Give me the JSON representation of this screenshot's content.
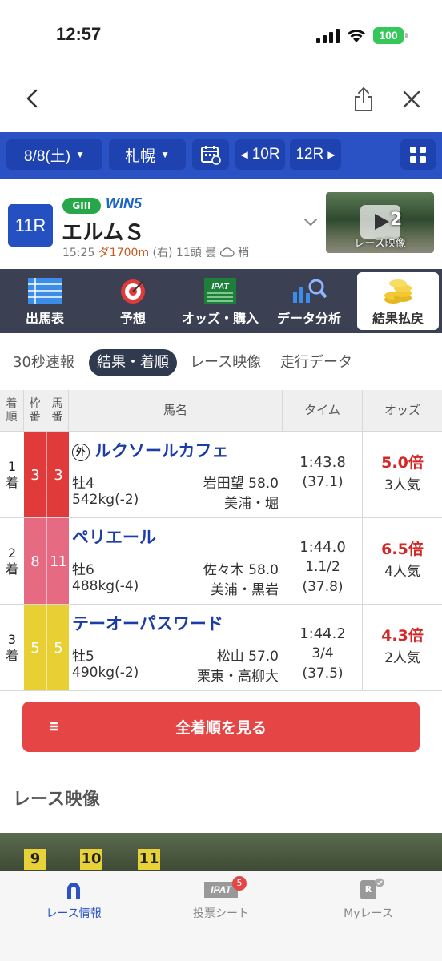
{
  "status": {
    "time": "12:57",
    "battery": "100"
  },
  "header": {
    "date": "8/8(土)",
    "venue": "札幌",
    "prev_race": "10R",
    "next_race": "12R"
  },
  "race": {
    "number": "11R",
    "grade": "GIII",
    "win5_label": "WIN",
    "win5_num": "5",
    "name": "エルムＳ",
    "time": "15:25",
    "course": "ダ1700m",
    "meta_rest": "(右) 11頭 曇",
    "track_cond": "稍",
    "video_label": "レース映像",
    "video_num": "2"
  },
  "menu": [
    "出馬表",
    "予想",
    "オッズ・購入",
    "データ分析",
    "結果払戻"
  ],
  "subtabs": [
    "30秒速報",
    "結果・着順",
    "レース映像",
    "走行データ"
  ],
  "table": {
    "headers": {
      "rank": "着順",
      "waku": "枠番",
      "uma": "馬番",
      "name": "馬名",
      "time": "タイム",
      "odds": "オッズ"
    },
    "rows": [
      {
        "rank": "1",
        "rank_suffix": "着",
        "waku": "3",
        "uma": "3",
        "gai": "外",
        "name": "ルクソールカフェ",
        "sexage": "牡4",
        "jockey": "岩田望 58.0",
        "weight": "542kg(-2)",
        "trainer": "美浦・堀",
        "time": "1:43.8",
        "margin": "",
        "last3f": "(37.1)",
        "odds": "5.0倍",
        "pop": "3人気",
        "color": "#e03a3a"
      },
      {
        "rank": "2",
        "rank_suffix": "着",
        "waku": "8",
        "uma": "11",
        "gai": "",
        "name": "ペリエール",
        "sexage": "牡6",
        "jockey": "佐々木 58.0",
        "weight": "488kg(-4)",
        "trainer": "美浦・黒岩",
        "time": "1:44.0",
        "margin": "1.1/2",
        "last3f": "(37.8)",
        "odds": "6.5倍",
        "pop": "4人気",
        "color": "#e56a82"
      },
      {
        "rank": "3",
        "rank_suffix": "着",
        "waku": "5",
        "uma": "5",
        "gai": "",
        "name": "テーオーパスワード",
        "sexage": "牡5",
        "jockey": "松山 57.0",
        "weight": "490kg(-2)",
        "trainer": "栗東・高柳大",
        "time": "1:44.2",
        "margin": "3/4",
        "last3f": "(37.5)",
        "odds": "4.3倍",
        "pop": "2人気",
        "color": "#e8cf33"
      }
    ]
  },
  "all_results_button": "全着順を見る",
  "section_video": "レース映像",
  "gate_numbers": [
    "9",
    "10",
    "11"
  ],
  "tabbar": [
    {
      "label": "レース情報"
    },
    {
      "label": "投票シート",
      "icon_text": "IPAT",
      "badge": "5"
    },
    {
      "label": "Myレース",
      "icon_text": "R"
    }
  ]
}
